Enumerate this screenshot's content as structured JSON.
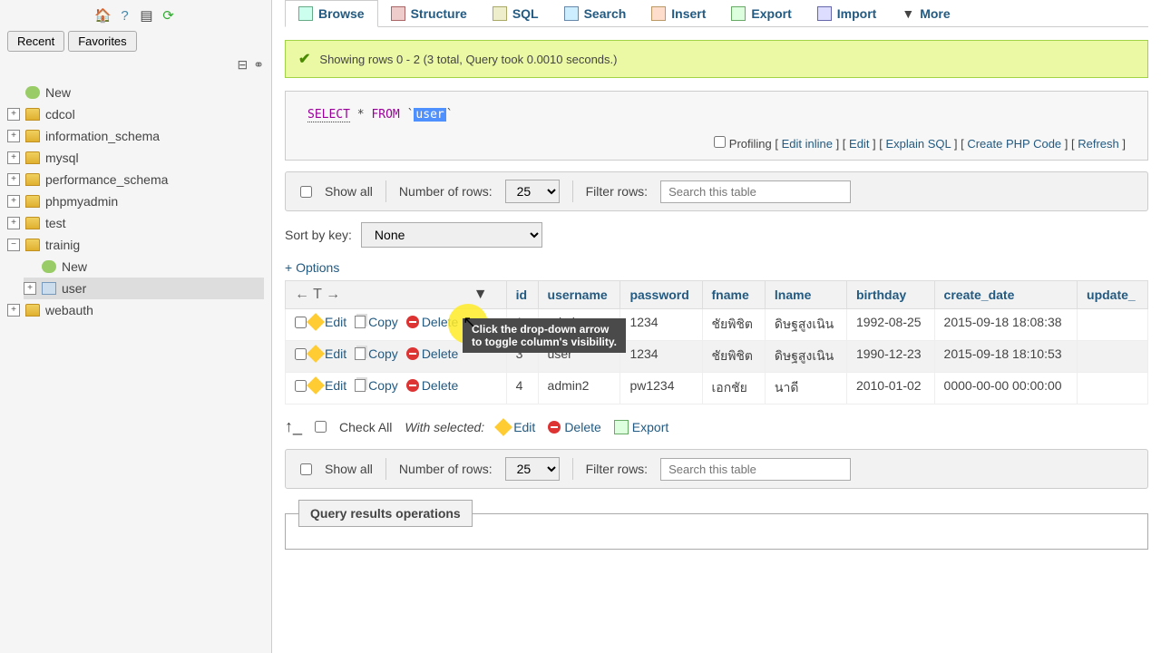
{
  "sidebar": {
    "tabs": {
      "recent": "Recent",
      "favorites": "Favorites"
    },
    "tree": {
      "new": "New",
      "dbs": [
        "cdcol",
        "information_schema",
        "mysql",
        "performance_schema",
        "phpmyadmin",
        "test"
      ],
      "trainig": {
        "name": "trainig",
        "new": "New",
        "table": "user"
      },
      "webauth": "webauth"
    }
  },
  "topnav": {
    "browse": "Browse",
    "structure": "Structure",
    "sql": "SQL",
    "search": "Search",
    "insert": "Insert",
    "export": "Export",
    "import": "Import",
    "more": "More"
  },
  "success": "Showing rows 0 - 2 (3 total, Query took 0.0010 seconds.)",
  "sql": {
    "select": "SELECT",
    "star": "*",
    "from": "FROM",
    "table": "user"
  },
  "sqlActions": {
    "profiling": "Profiling",
    "editInline": "Edit inline",
    "edit": "Edit",
    "explain": "Explain SQL",
    "php": "Create PHP Code",
    "refresh": "Refresh"
  },
  "controls": {
    "showAll": "Show all",
    "numRows": "Number of rows:",
    "rowsVal": "25",
    "filter": "Filter rows:",
    "placeholder": "Search this table"
  },
  "sort": {
    "label": "Sort by key:",
    "value": "None"
  },
  "options": "+ Options",
  "tooltip": {
    "l1": "Click the drop-down arrow",
    "l2": "to toggle column's visibility."
  },
  "cols": {
    "id": "id",
    "username": "username",
    "password": "password",
    "fname": "fname",
    "lname": "lname",
    "birthday": "birthday",
    "create_date": "create_date",
    "update": "update_"
  },
  "rowLabels": {
    "edit": "Edit",
    "copy": "Copy",
    "delete": "Delete"
  },
  "rows": [
    {
      "id": "1",
      "username": "admin",
      "password": "1234",
      "fname": "ชัยพิชิต",
      "lname": "ดิษฐสูงเนิน",
      "birthday": "1992-08-25",
      "create_date": "2015-09-18 18:08:38"
    },
    {
      "id": "3",
      "username": "user",
      "password": "1234",
      "fname": "ชัยพิชิต",
      "lname": "ดิษฐสูงเนิน",
      "birthday": "1990-12-23",
      "create_date": "2015-09-18 18:10:53"
    },
    {
      "id": "4",
      "username": "admin2",
      "password": "pw1234",
      "fname": "เอกชัย",
      "lname": "นาดี",
      "birthday": "2010-01-02",
      "create_date": "0000-00-00 00:00:00"
    }
  ],
  "bulk": {
    "checkAll": "Check All",
    "withSelected": "With selected:",
    "edit": "Edit",
    "delete": "Delete",
    "export": "Export"
  },
  "fieldset": "Query results operations"
}
